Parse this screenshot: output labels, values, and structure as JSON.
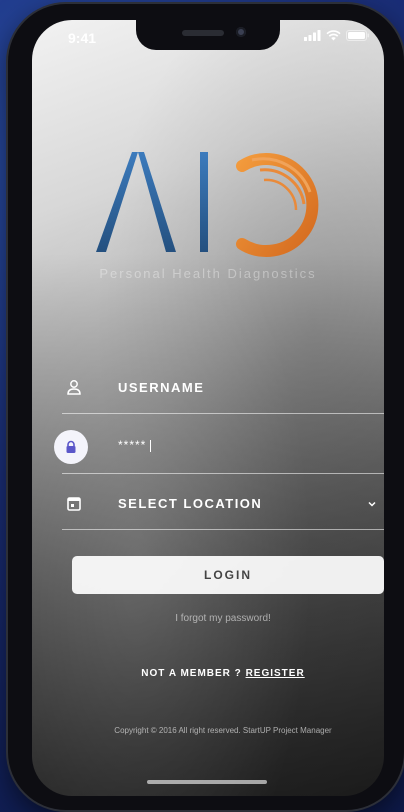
{
  "status_bar": {
    "time": "9:41",
    "icons": [
      "signal-icon",
      "wifi-icon",
      "battery-icon"
    ]
  },
  "brand": {
    "logo_text": "AIO",
    "tagline": "Personal Health Diagnostics",
    "colors": {
      "blue": "#2f6aa6",
      "orange": "#e57c2c"
    }
  },
  "form": {
    "username": {
      "placeholder": "USERNAME",
      "icon": "user-icon"
    },
    "password": {
      "value": "*****",
      "icon": "lock-icon"
    },
    "location": {
      "placeholder": "SELECT LOCATION",
      "icon": "calendar-icon",
      "dropdown_icon": "chevron-down-icon"
    },
    "login_label": "LOGIN"
  },
  "links": {
    "forgot": "I forgot my password!",
    "not_member": "NOT A MEMBER ?",
    "register": "REGISTER"
  },
  "footer": {
    "copyright": "Copyright © 2016 All right reserved. StartUP Project Manager"
  }
}
